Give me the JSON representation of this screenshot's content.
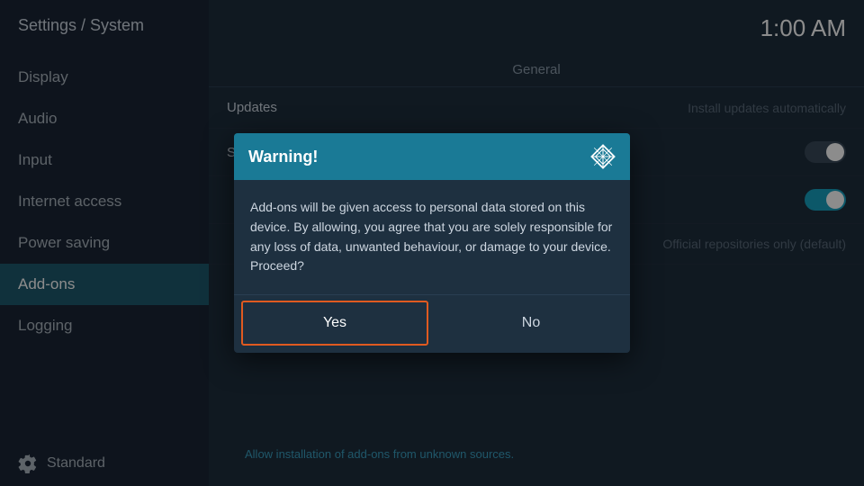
{
  "sidebar": {
    "title": "Settings / System",
    "items": [
      {
        "id": "display",
        "label": "Display",
        "active": false
      },
      {
        "id": "audio",
        "label": "Audio",
        "active": false
      },
      {
        "id": "input",
        "label": "Input",
        "active": false
      },
      {
        "id": "internet-access",
        "label": "Internet access",
        "active": false
      },
      {
        "id": "power-saving",
        "label": "Power saving",
        "active": false
      },
      {
        "id": "add-ons",
        "label": "Add-ons",
        "active": true
      },
      {
        "id": "logging",
        "label": "Logging",
        "active": false
      }
    ],
    "footer": {
      "label": "Standard"
    }
  },
  "header": {
    "time": "1:00 AM"
  },
  "main": {
    "section_title": "General",
    "rows": [
      {
        "id": "updates",
        "label": "Updates",
        "value": "Install updates automatically",
        "type": "text"
      },
      {
        "id": "show-notifications",
        "label": "Show notifications",
        "value": "",
        "type": "toggle-off"
      },
      {
        "id": "unknown-sources",
        "label": "",
        "value": "",
        "type": "toggle-on"
      },
      {
        "id": "repo-source",
        "label": "",
        "value": "Official repositories only (default)",
        "type": "text-dim"
      }
    ],
    "status_hint": "Allow installation of add-ons from unknown sources."
  },
  "dialog": {
    "title": "Warning!",
    "body": "Add-ons will be given access to personal data stored on this device. By allowing, you agree that you are solely responsible for any loss of data, unwanted behaviour, or damage to your device. Proceed?",
    "btn_yes": "Yes",
    "btn_no": "No"
  }
}
